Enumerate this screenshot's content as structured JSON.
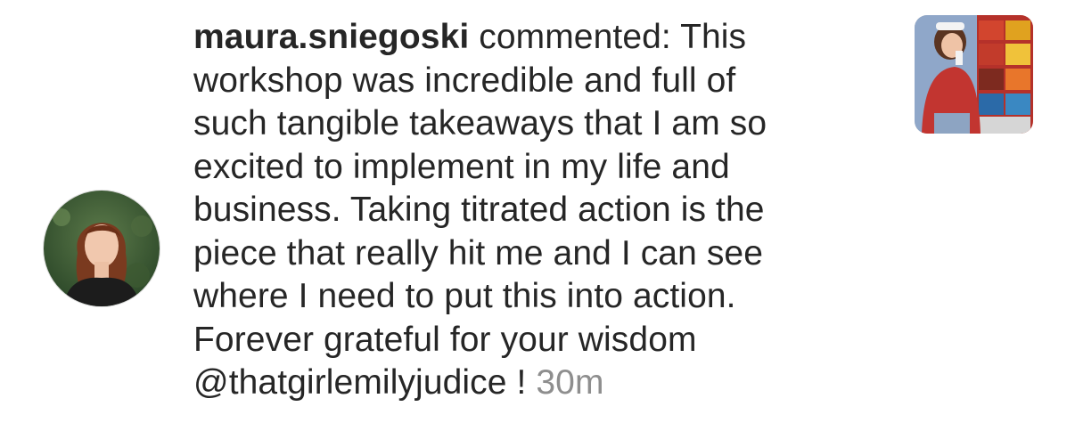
{
  "notification": {
    "username": "maura.sniegoski",
    "action": "commented:",
    "comment_lines": [
      "This\nworkshop was incredible and full of\nsuch tangible takeaways that I am so\nexcited to implement in my life and\nbusiness. Taking titrated action is the\npiece that really hit me and I can see\nwhere I need to put this into action.\nForever grateful for your wisdom\n"
    ],
    "mention": "@thatgirlemilyjudice",
    "suffix": "!",
    "timestamp": "30m",
    "avatar_icon": "profile-photo",
    "thumbnail_icon": "post-thumbnail"
  },
  "colors": {
    "text": "#262626",
    "timestamp": "#8e8e8e",
    "background": "#ffffff"
  }
}
